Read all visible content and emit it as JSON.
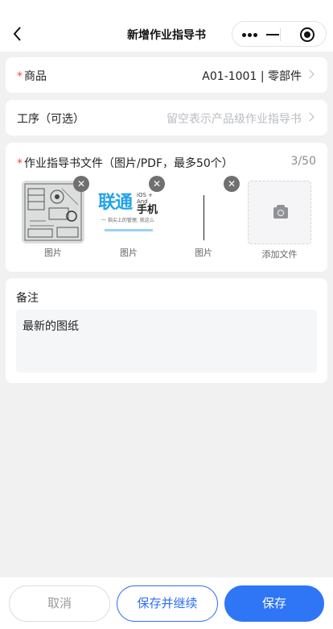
{
  "header": {
    "title": "新增作业指导书"
  },
  "product": {
    "label": "商品",
    "value": "A01-1001 | 零部件"
  },
  "process": {
    "label": "工序（可选）",
    "placeholder": "留空表示产品级作业指导书"
  },
  "files": {
    "label": "作业指导书文件（图片/PDF，最多50个）",
    "count": "3/50",
    "items": [
      {
        "caption": "图片"
      },
      {
        "caption": "图片"
      },
      {
        "caption": "图片"
      }
    ],
    "add_label": "添加文件",
    "thumb2_big": "联通",
    "thumb2_text": "手机",
    "thumb2_small": "iOS + And",
    "thumb2_line": "一 指尖上的管理, 就这么"
  },
  "remark": {
    "label": "备注",
    "value": "最新的图纸"
  },
  "footer": {
    "cancel": "取消",
    "save_continue": "保存并继续",
    "save": "保存"
  },
  "colors": {
    "accent": "#2f76f6",
    "required": "#f04a3a",
    "background": "#f1f1f2"
  }
}
